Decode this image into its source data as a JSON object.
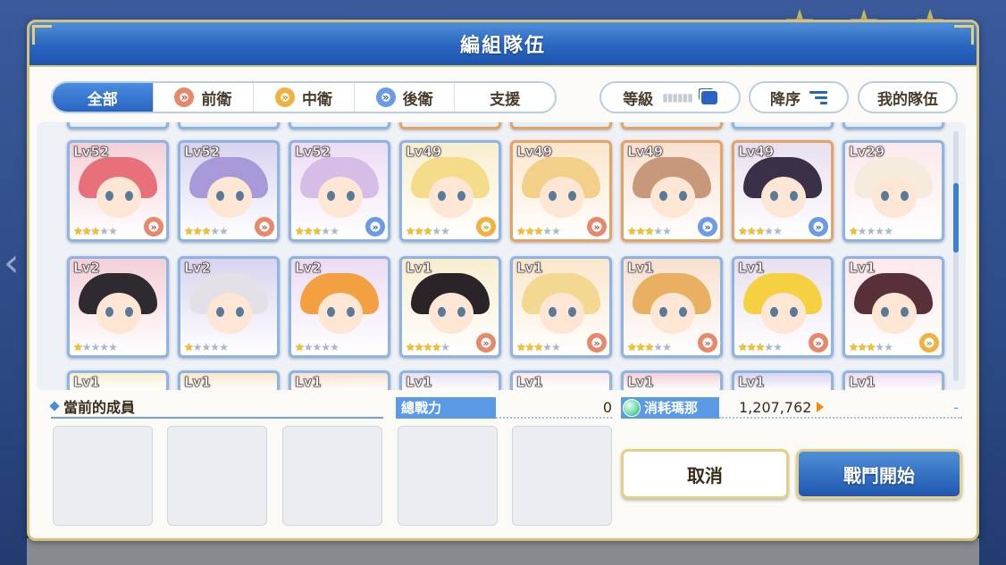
{
  "dialog": {
    "title": "編組隊伍"
  },
  "filters": {
    "tabs": [
      {
        "label": "全部",
        "active": true
      },
      {
        "label": "前衛",
        "icon": "red-position-ring-icon"
      },
      {
        "label": "中衛",
        "icon": "orange-position-ring-icon"
      },
      {
        "label": "後衛",
        "icon": "blue-position-ring-icon"
      },
      {
        "label": "支援"
      }
    ],
    "level_sort_label": "等級",
    "order_label": "降序",
    "my_team_label": "我的隊伍"
  },
  "roster": {
    "row1": [
      {
        "level": "Lv52",
        "stars": 3,
        "position": "red",
        "hair": "#e8707a"
      },
      {
        "level": "Lv52",
        "stars": 3,
        "position": "red",
        "hair": "#a89ad8"
      },
      {
        "level": "Lv52",
        "stars": 3,
        "position": "blue",
        "hair": "#d6bde8"
      },
      {
        "level": "Lv49",
        "stars": 3,
        "position": "orange",
        "hair": "#f5dc8a"
      },
      {
        "level": "Lv49",
        "stars": 3,
        "position": "red",
        "hair": "#f2d08a"
      },
      {
        "level": "Lv49",
        "stars": 3,
        "position": "blue",
        "hair": "#c8987a"
      },
      {
        "level": "Lv49",
        "stars": 3,
        "position": "blue",
        "hair": "#3a3048"
      },
      {
        "level": "Lv29",
        "stars": 1,
        "position": "none",
        "hair": "#f5ecde"
      }
    ],
    "row2": [
      {
        "level": "Lv2",
        "stars": 1,
        "position": "none",
        "hair": "#2e2a30"
      },
      {
        "level": "Lv2",
        "stars": 1,
        "position": "none",
        "hair": "#e4e0e8"
      },
      {
        "level": "Lv2",
        "stars": 1,
        "position": "none",
        "hair": "#f2a040"
      },
      {
        "level": "Lv1",
        "stars": 4,
        "position": "red",
        "hair": "#2a2428"
      },
      {
        "level": "Lv1",
        "stars": 3,
        "position": "red",
        "hair": "#f2d890"
      },
      {
        "level": "Lv1",
        "stars": 3,
        "position": "red",
        "hair": "#e8b060"
      },
      {
        "level": "Lv1",
        "stars": 3,
        "position": "red",
        "hair": "#f5d040"
      },
      {
        "level": "Lv1",
        "stars": 3,
        "position": "orange",
        "hair": "#5a3038"
      }
    ],
    "row3_levels": [
      "Lv1",
      "Lv1",
      "Lv1",
      "Lv1",
      "Lv1",
      "Lv1",
      "Lv1",
      "Lv1"
    ]
  },
  "team": {
    "members_label": "當前的成員",
    "power_label": "總戰力",
    "power_value": "0",
    "mana_label": "消耗瑪那",
    "mana_value": "1,207,762",
    "mana_dash": "-"
  },
  "buttons": {
    "cancel": "取消",
    "start": "戰鬥開始"
  },
  "colors": {
    "header_blue": "#2a66c0",
    "gold_border": "#d6c27a",
    "accent_blue": "#5b9ae6",
    "start_button": "#1f56b0"
  }
}
